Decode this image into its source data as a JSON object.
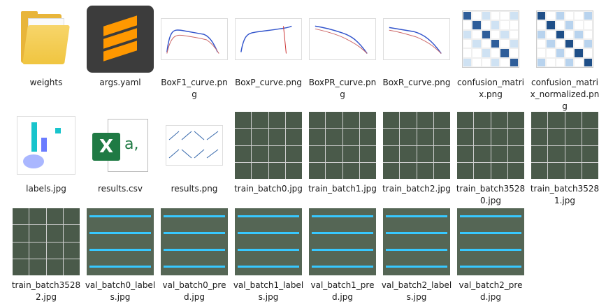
{
  "files": [
    {
      "label": "weights",
      "icon": "folder-icon"
    },
    {
      "label": "args.yaml",
      "icon": "sublime-icon"
    },
    {
      "label": "BoxF1_curve.png",
      "icon": "chart-icon"
    },
    {
      "label": "BoxP_curve.png",
      "icon": "chart-icon"
    },
    {
      "label": "BoxPR_curve.png",
      "icon": "chart-icon"
    },
    {
      "label": "BoxR_curve.png",
      "icon": "chart-icon"
    },
    {
      "label": "confusion_matrix.png",
      "icon": "confusion-icon"
    },
    {
      "label": "confusion_matrix_normalized.png",
      "icon": "confusion-icon"
    },
    {
      "label": "labels.jpg",
      "icon": "labels-icon"
    },
    {
      "label": "results.csv",
      "icon": "excel-icon"
    },
    {
      "label": "results.png",
      "icon": "results-icon"
    },
    {
      "label": "train_batch0.jpg",
      "icon": "mosaic-icon"
    },
    {
      "label": "train_batch1.jpg",
      "icon": "mosaic-icon"
    },
    {
      "label": "train_batch2.jpg",
      "icon": "mosaic-icon"
    },
    {
      "label": "train_batch35280.jpg",
      "icon": "mosaic-icon"
    },
    {
      "label": "train_batch35281.jpg",
      "icon": "mosaic-icon"
    },
    {
      "label": "train_batch35282.jpg",
      "icon": "mosaic-icon"
    },
    {
      "label": "val_batch0_labels.jpg",
      "icon": "val-icon"
    },
    {
      "label": "val_batch0_pred.jpg",
      "icon": "val-icon"
    },
    {
      "label": "val_batch1_labels.jpg",
      "icon": "val-icon"
    },
    {
      "label": "val_batch1_pred.jpg",
      "icon": "val-icon"
    },
    {
      "label": "val_batch2_labels.jpg",
      "icon": "val-icon"
    },
    {
      "label": "val_batch2_pred.jpg",
      "icon": "val-icon"
    }
  ]
}
